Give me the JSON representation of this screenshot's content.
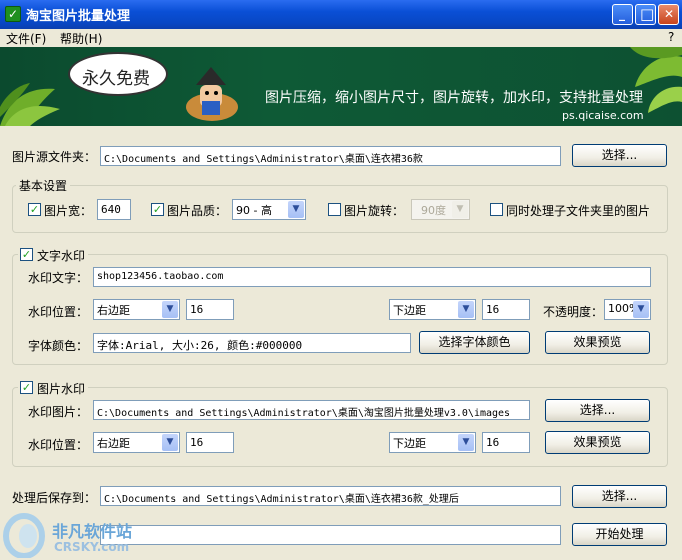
{
  "window": {
    "title": "淘宝图片批量处理",
    "check_glyph": "✓",
    "min_glyph": "_",
    "max_glyph": "□",
    "close_glyph": "✕"
  },
  "menu": {
    "file": "文件(F)",
    "help": "帮助(H)",
    "question": "?"
  },
  "banner": {
    "bubble": "永久免费",
    "slogan": "图片压缩，缩小图片尺寸，图片旋转，加水印，支持批量处理",
    "url": "ps.qicaise.com"
  },
  "source": {
    "label": "图片源文件夹：",
    "value": "C:\\Documents and Settings\\Administrator\\桌面\\连衣裙36款",
    "button": "选择..."
  },
  "basic": {
    "legend": "基本设置",
    "width_label": "图片宽：",
    "width_value": "640",
    "width_checked": true,
    "quality_label": "图片品质：",
    "quality_value": "90 - 高",
    "quality_checked": true,
    "rotate_label": "图片旋转：",
    "rotate_value": "90度",
    "rotate_checked": false,
    "subfolder_label": "同时处理子文件夹里的图片",
    "subfolder_checked": false
  },
  "text_watermark": {
    "legend": "文字水印",
    "checked": true,
    "text_label": "水印文字：",
    "text_value": "shop123456.taobao.com",
    "pos_label": "水印位置：",
    "h_pos": "右边距",
    "h_value": "16",
    "v_pos": "下边距",
    "v_value": "16",
    "opacity_label": "不透明度：",
    "opacity_value": "100%",
    "font_label": "字体颜色：",
    "font_value": "字体:Arial, 大小:26, 颜色:#000000",
    "font_button": "选择字体颜色",
    "preview_button": "效果预览"
  },
  "image_watermark": {
    "legend": "图片水印",
    "checked": true,
    "image_label": "水印图片：",
    "image_value": "C:\\Documents and Settings\\Administrator\\桌面\\淘宝图片批量处理v3.0\\images",
    "image_button": "选择...",
    "pos_label": "水印位置：",
    "h_pos": "右边距",
    "h_value": "16",
    "v_pos": "下边距",
    "v_value": "16",
    "preview_button": "效果预览"
  },
  "output": {
    "label": "处理后保存到：",
    "value": "C:\\Documents and Settings\\Administrator\\桌面\\连衣裙36款_处理后",
    "button": "选择..."
  },
  "start": {
    "progress_value": "",
    "button": "开始处理"
  },
  "watermark": {
    "site": "非凡软件站",
    "domain": "CRSKY.com"
  },
  "colors": {
    "accent": "#0a4fd6",
    "banner": "#0d5132",
    "check": "#21a121"
  }
}
